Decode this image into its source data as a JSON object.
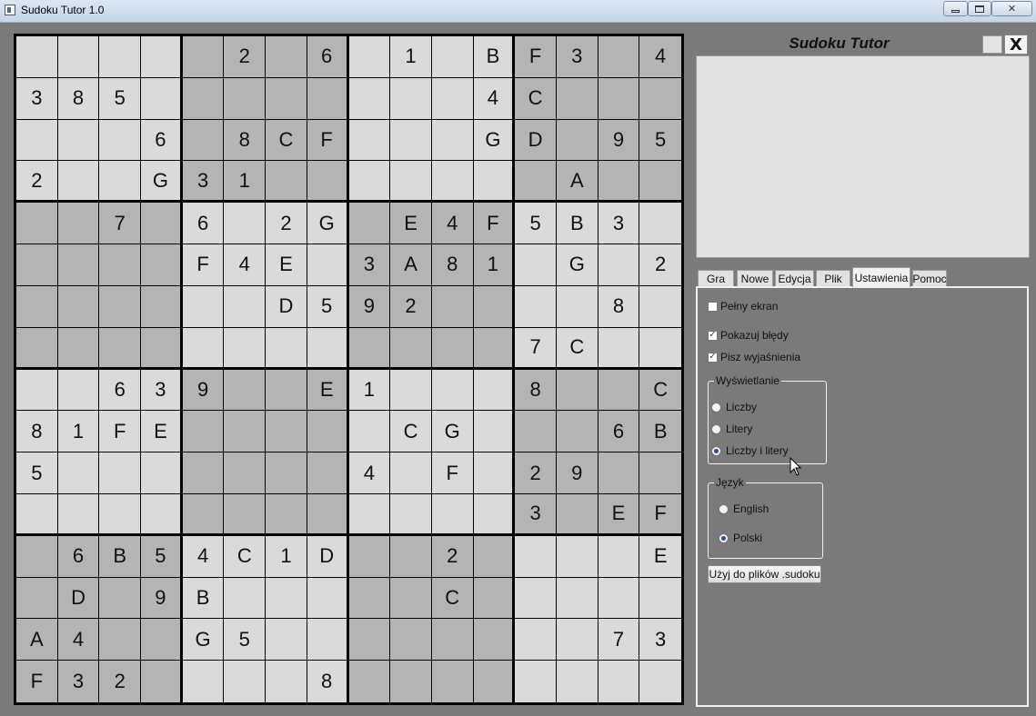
{
  "window": {
    "title": "Sudoku Tutor 1.0",
    "min": "",
    "max": "",
    "close": "✕"
  },
  "panel": {
    "title": "Sudoku Tutor",
    "close_label": "X"
  },
  "tabs": [
    {
      "label": "Gra",
      "active": false
    },
    {
      "label": "Nowe",
      "active": false
    },
    {
      "label": "Edycja",
      "active": false
    },
    {
      "label": "Plik",
      "active": false
    },
    {
      "label": "Ustawienia",
      "active": true
    },
    {
      "label": "Pomoc",
      "active": false
    }
  ],
  "settings": {
    "fullscreen": {
      "label": "Pełny ekran",
      "checked": false
    },
    "show_errors": {
      "label": "Pokazuj błędy",
      "checked": true
    },
    "write_explanations": {
      "label": "Pisz wyjaśnienia",
      "checked": true
    },
    "display_group": {
      "title": "Wyświetlanie",
      "options": [
        {
          "label": "Liczby",
          "selected": false
        },
        {
          "label": "Litery",
          "selected": false
        },
        {
          "label": "Liczby i litery",
          "selected": true
        }
      ]
    },
    "language_group": {
      "title": "Język",
      "options": [
        {
          "label": "English",
          "selected": false
        },
        {
          "label": "Polski",
          "selected": true
        }
      ]
    },
    "use_for_files_button": "Użyj do plików .sudoku"
  },
  "board": {
    "size": 16,
    "colors": {
      "light": "#dadada",
      "dark": "#b4b4b4"
    },
    "rows": [
      [
        "",
        "",
        "",
        "",
        "",
        "2",
        "",
        "6",
        "",
        "1",
        "",
        "B",
        "F",
        "3",
        "",
        "4"
      ],
      [
        "3",
        "8",
        "5",
        "",
        "",
        "",
        "",
        "",
        "",
        "",
        "",
        "4",
        "C",
        "",
        "",
        ""
      ],
      [
        "",
        "",
        "",
        "6",
        "",
        "8",
        "C",
        "F",
        "",
        "",
        "",
        "G",
        "D",
        "",
        "9",
        "5"
      ],
      [
        "2",
        "",
        "",
        "G",
        "3",
        "1",
        "",
        "",
        "",
        "",
        "",
        "",
        "",
        "A",
        "",
        ""
      ],
      [
        "",
        "",
        "7",
        "",
        "6",
        "",
        "2",
        "G",
        "",
        "E",
        "4",
        "F",
        "5",
        "B",
        "3",
        ""
      ],
      [
        "",
        "",
        "",
        "",
        "F",
        "4",
        "E",
        "",
        "3",
        "A",
        "8",
        "1",
        "",
        "G",
        "",
        "2"
      ],
      [
        "",
        "",
        "",
        "",
        "",
        "",
        "D",
        "5",
        "9",
        "2",
        "",
        "",
        "",
        "",
        "8",
        ""
      ],
      [
        "",
        "",
        "",
        "",
        "",
        "",
        "",
        "",
        "",
        "",
        "",
        "",
        "7",
        "C",
        "",
        ""
      ],
      [
        "",
        "",
        "6",
        "3",
        "9",
        "",
        "",
        "E",
        "1",
        "",
        "",
        "",
        "8",
        "",
        "",
        "C"
      ],
      [
        "8",
        "1",
        "F",
        "E",
        "",
        "",
        "",
        "",
        "",
        "C",
        "G",
        "",
        "",
        "",
        "6",
        "B"
      ],
      [
        "5",
        "",
        "",
        "",
        "",
        "",
        "",
        "",
        "4",
        "",
        "F",
        "",
        "2",
        "9",
        "",
        ""
      ],
      [
        "",
        "",
        "",
        "",
        "",
        "",
        "",
        "",
        "",
        "",
        "",
        "",
        "3",
        "",
        "E",
        "F"
      ],
      [
        "",
        "6",
        "B",
        "5",
        "4",
        "C",
        "1",
        "D",
        "",
        "",
        "2",
        "",
        "",
        "",
        "",
        "E"
      ],
      [
        "",
        "D",
        "",
        "9",
        "B",
        "",
        "",
        "",
        "",
        "",
        "C",
        "",
        "",
        "",
        "",
        ""
      ],
      [
        "A",
        "4",
        "",
        "",
        "G",
        "5",
        "",
        "",
        "",
        "",
        "",
        "",
        "",
        "",
        "7",
        "3"
      ],
      [
        "F",
        "3",
        "2",
        "",
        "",
        "",
        "",
        "8",
        "",
        "",
        "",
        "",
        "",
        "",
        "",
        ""
      ]
    ]
  }
}
